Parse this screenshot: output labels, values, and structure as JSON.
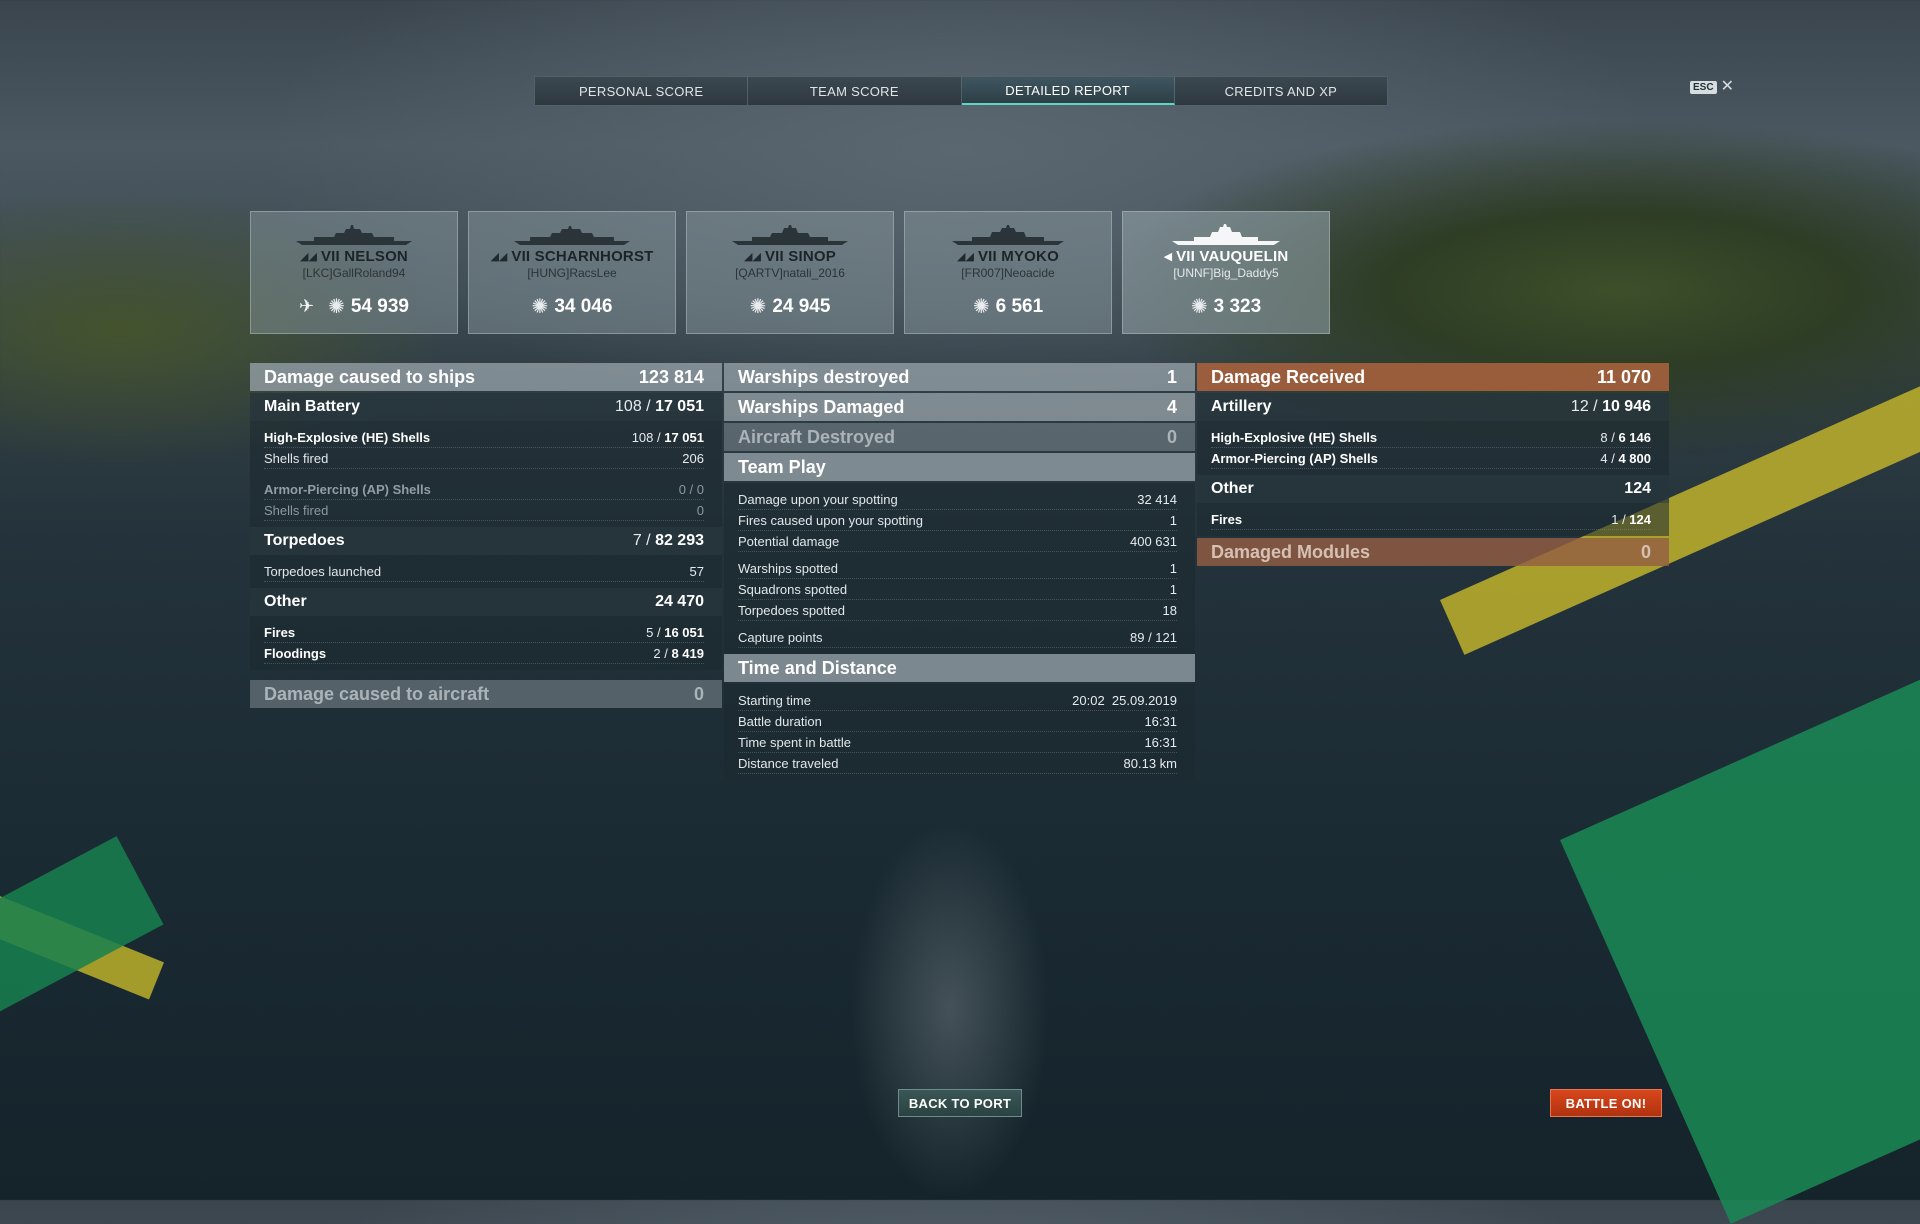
{
  "tabs": [
    "PERSONAL SCORE",
    "TEAM SCORE",
    "DETAILED REPORT",
    "CREDITS AND XP"
  ],
  "active_tab": "DETAILED REPORT",
  "esc": {
    "key": "ESC",
    "close": "✕"
  },
  "ships": [
    {
      "name": "VII NELSON",
      "player": "[LKC]GallRoland94",
      "damage": "54 939",
      "class_icon": "battleship-icon",
      "has_plane": true
    },
    {
      "name": "VII SCHARNHORST",
      "player": "[HUNG]RacsLee",
      "damage": "34 046",
      "class_icon": "battleship-icon"
    },
    {
      "name": "VII SINOP",
      "player": "[QARTV]natali_2016",
      "damage": "24 945",
      "class_icon": "battleship-icon"
    },
    {
      "name": "VII MYOKO",
      "player": "[FR007]Neoacide",
      "damage": "6 561",
      "class_icon": "cruiser-icon"
    },
    {
      "name": "VII VAUQUELIN",
      "player": "[UNNF]Big_Daddy5",
      "damage": "3 323",
      "class_icon": "destroyer-icon",
      "highlight": true
    }
  ],
  "damage_ships": {
    "title": "Damage caused to ships",
    "value": "123 814",
    "main_battery": {
      "label": "Main Battery",
      "hits": "108",
      "damage": "17 051"
    },
    "he": {
      "label": "High-Explosive (HE) Shells",
      "hits": "108",
      "damage": "17 051",
      "fired_label": "Shells fired",
      "fired": "206"
    },
    "ap": {
      "label": "Armor-Piercing (AP) Shells",
      "hits": "0",
      "damage": "0",
      "fired_label": "Shells fired",
      "fired": "0"
    },
    "torpedoes": {
      "label": "Torpedoes",
      "hits": "7",
      "damage": "82 293",
      "launched_label": "Torpedoes launched",
      "launched": "57"
    },
    "other": {
      "label": "Other",
      "value": "24 470",
      "fires_label": "Fires",
      "fires_hits": "5",
      "fires_damage": "16 051",
      "flood_label": "Floodings",
      "flood_hits": "2",
      "flood_damage": "8 419"
    }
  },
  "damage_aircraft": {
    "title": "Damage caused to aircraft",
    "value": "0"
  },
  "warships_destroyed": {
    "label": "Warships destroyed",
    "value": "1"
  },
  "warships_damaged": {
    "label": "Warships Damaged",
    "value": "4"
  },
  "aircraft_destroyed": {
    "label": "Aircraft Destroyed",
    "value": "0"
  },
  "team_play": {
    "title": "Team Play",
    "spotting_damage": {
      "label": "Damage upon your spotting",
      "value": "32 414"
    },
    "spotting_fires": {
      "label": "Fires caused upon your spotting",
      "value": "1"
    },
    "potential": {
      "label": "Potential damage",
      "value": "400 631"
    },
    "warships_spotted": {
      "label": "Warships spotted",
      "value": "1"
    },
    "squadrons_spotted": {
      "label": "Squadrons spotted",
      "value": "1"
    },
    "torpedoes_spotted": {
      "label": "Torpedoes spotted",
      "value": "18"
    },
    "capture": {
      "label": "Capture points",
      "value": "89 / 121"
    }
  },
  "time_distance": {
    "title": "Time and Distance",
    "start": {
      "label": "Starting time",
      "time": "20:02",
      "date": "25.09.2019"
    },
    "duration": {
      "label": "Battle duration",
      "value": "16:31"
    },
    "spent": {
      "label": "Time spent in battle",
      "value": "16:31"
    },
    "distance": {
      "label": "Distance traveled",
      "value": "80.13 km"
    }
  },
  "damage_received": {
    "title": "Damage Received",
    "value": "11 070",
    "artillery": {
      "label": "Artillery",
      "hits": "12",
      "damage": "10 946"
    },
    "he": {
      "label": "High-Explosive (HE) Shells",
      "hits": "8",
      "damage": "6 146"
    },
    "ap": {
      "label": "Armor-Piercing (AP) Shells",
      "hits": "4",
      "damage": "4 800"
    },
    "other": {
      "label": "Other",
      "value": "124",
      "fires_label": "Fires",
      "fires_hits": "1",
      "fires_damage": "124"
    }
  },
  "damaged_modules": {
    "label": "Damaged Modules",
    "value": "0"
  },
  "buttons": {
    "back": "BACK TO PORT",
    "battle": "BATTLE ON!"
  },
  "colors": {
    "accent": "#5dd6c5",
    "battle_button": "#c93c16",
    "received_header": "#a8623e"
  }
}
